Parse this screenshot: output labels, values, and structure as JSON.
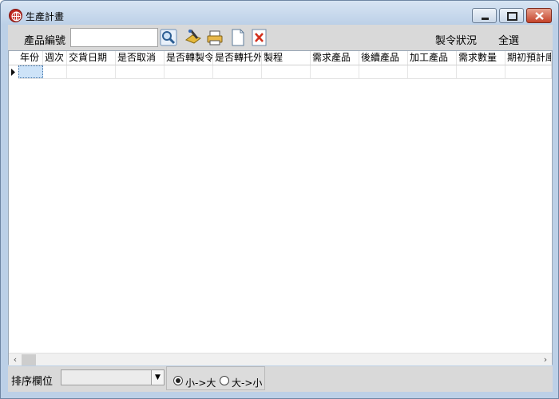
{
  "window": {
    "title": "生產計畫"
  },
  "toolbar": {
    "product_no_label": "產品編號",
    "search_value": "",
    "mo_status_label": "製令狀況",
    "select_all_label": "全選"
  },
  "grid": {
    "columns": [
      "年份",
      "週次",
      "交貨日期",
      "是否取消",
      "是否轉製令",
      "是否轉托外",
      "製程",
      "需求產品",
      "後續產品",
      "加工產品",
      "需求數量",
      "期初預計庫"
    ]
  },
  "bottom": {
    "sort_label": "排序欄位",
    "sort_value": "",
    "asc_label": "小->大",
    "desc_label": "大->小",
    "order_selected": "asc"
  },
  "colors": {
    "titlebar": "#bcd0e7",
    "panel": "#d9d9d9",
    "selection": "#cde3f8"
  }
}
